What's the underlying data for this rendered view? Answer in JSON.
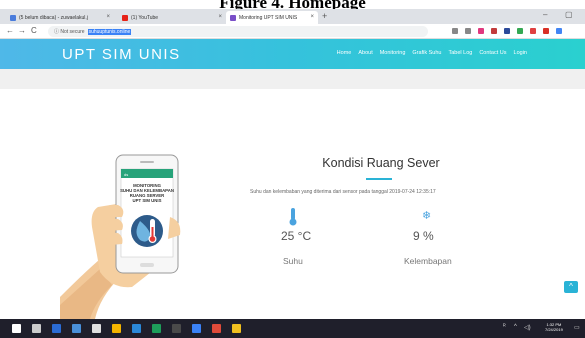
{
  "figure_caption": "Figure 4. Homepage",
  "browser": {
    "tabs": [
      {
        "label": "(5 belum dibaca) - zuwaelakul.j",
        "icon_color": "#4a7cdc"
      },
      {
        "label": "(1) YouTube",
        "icon_color": "#e62117"
      },
      {
        "label": "Monitoring UPT SIM UNIS",
        "icon_color": "#7a4fc8"
      }
    ],
    "new_tab": "+",
    "window_controls": [
      "–",
      "▢"
    ],
    "nav": {
      "back": "←",
      "forward": "→",
      "reload": "C"
    },
    "url": {
      "security": "ⓘ Not secure",
      "host": "suhuuptunis.online"
    },
    "extension_colors": [
      "#888888",
      "#888888",
      "#e0387e",
      "#c23b3b",
      "#2c4a9a",
      "#34a853",
      "#e04040",
      "#d93025",
      "#4285f4"
    ]
  },
  "site": {
    "brand": "UPT SIM UNIS",
    "menu": [
      "Home",
      "About",
      "Monitoring",
      "Grafik Suhu",
      "Tabel Log",
      "Contact Us",
      "Login"
    ],
    "phone_text": [
      "MONITORING",
      "SUHU DAN KELEMBAPAN",
      "RUANG SERVER",
      "UPT SIM UNIS"
    ],
    "title": "Kondisi Ruang Sever",
    "description": "Suhu dan kelembaban yang diterima dari sensor pada tanggal 2019-07-24 12:35:17",
    "temperature": {
      "value": "25 °C",
      "label": "Suhu",
      "icon": "thermometer-icon"
    },
    "humidity": {
      "value": "9 %",
      "label": "Kelembapan",
      "icon": "snowflake-icon"
    },
    "scroll_up": "^",
    "colors": {
      "header_start": "#4fb8e8",
      "header_end": "#2ad0cf",
      "accent": "#2ab3d6"
    }
  },
  "taskbar": {
    "clock_time": "1:32 PM",
    "clock_date": "7/24/2019",
    "app_icon_colors": [
      "#ffffff",
      "#cccccc",
      "#2b6cd4",
      "#4a90d9",
      "#e0e0e0",
      "#f4b400",
      "#2b88d8",
      "#1e9e5a",
      "#4a4a4a",
      "#3b82f6",
      "#e04b3a",
      "#f0c020"
    ]
  }
}
